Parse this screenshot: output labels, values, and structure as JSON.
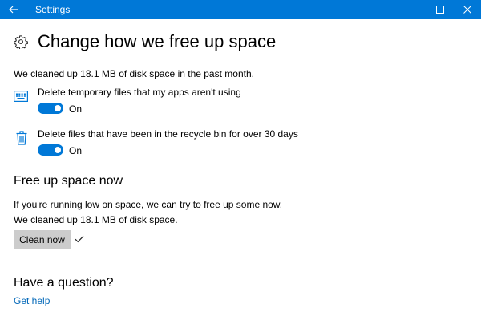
{
  "window": {
    "title": "Settings"
  },
  "page": {
    "title": "Change how we free up space",
    "summary": "We cleaned up 18.1 MB of disk space in the past month."
  },
  "settings": [
    {
      "label": "Delete temporary files that my apps aren't using",
      "state": "On",
      "on": true,
      "icon": "keyboard-icon"
    },
    {
      "label": "Delete files that have been in the recycle bin for over 30 days",
      "state": "On",
      "on": true,
      "icon": "recycle-bin-icon"
    }
  ],
  "free_up": {
    "heading": "Free up space now",
    "description": "If you're running low on space, we can try to free up some now.",
    "result": "We cleaned up 18.1 MB of disk space.",
    "button_label": "Clean now",
    "status_icon": "checkmark-icon"
  },
  "question": {
    "heading": "Have a question?",
    "link": "Get help"
  },
  "colors": {
    "accent": "#0078d7",
    "link": "#0067b8",
    "button": "#cccccc"
  }
}
